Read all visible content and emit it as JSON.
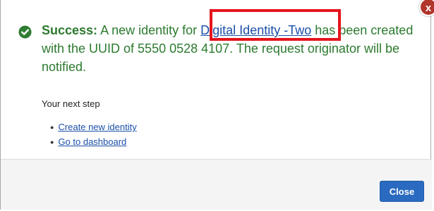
{
  "dialog": {
    "close_glyph": "x",
    "success": {
      "label": "Success:",
      "text_before_link": " A new identity for ",
      "identity_link": "Digital Identity -Two",
      "text_after_link": " has been created with the UUID of 5550 0528 4107. The request originator will be notified."
    },
    "next_step": {
      "heading": "Your next step",
      "links": [
        "Create new identity",
        "Go to dashboard"
      ]
    },
    "footer": {
      "close_label": "Close"
    }
  },
  "colors": {
    "success_text": "#2c7a2f",
    "link": "#1a4fa8",
    "highlight_border": "#e5141c",
    "primary_button": "#2a6ac0",
    "close_x": "#b0352a"
  }
}
